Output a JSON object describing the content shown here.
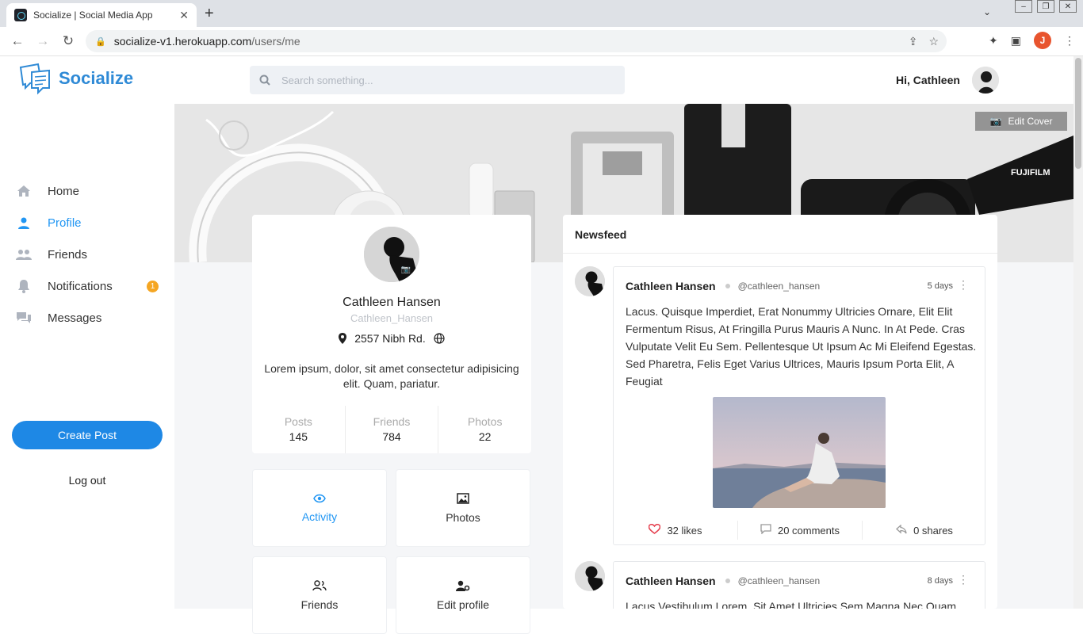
{
  "browser": {
    "tab_title": "Socialize | Social Media App",
    "url_host": "socialize-v1.herokuapp.com",
    "url_path": "/users/me",
    "profile_initial": "J"
  },
  "app": {
    "logo_text": "Socialize",
    "search_placeholder": "Search something...",
    "greeting": "Hi, Cathleen",
    "accent_color": "#1e88e5"
  },
  "sidebar": {
    "items": [
      {
        "label": "Home",
        "icon": "home-icon"
      },
      {
        "label": "Profile",
        "icon": "user-icon",
        "active": true
      },
      {
        "label": "Friends",
        "icon": "users-icon"
      },
      {
        "label": "Notifications",
        "icon": "bell-icon",
        "badge": "1"
      },
      {
        "label": "Messages",
        "icon": "chat-icon"
      }
    ],
    "create_post": "Create Post",
    "logout": "Log out"
  },
  "cover": {
    "edit_label": "Edit Cover"
  },
  "profile": {
    "name": "Cathleen Hansen",
    "handle": "Cathleen_Hansen",
    "location": "2557 Nibh Rd.",
    "bio": "Lorem ipsum, dolor, sit amet consectetur adipisicing elit. Quam, pariatur.",
    "stats": [
      {
        "label": "Posts",
        "value": "145"
      },
      {
        "label": "Friends",
        "value": "784"
      },
      {
        "label": "Photos",
        "value": "22"
      }
    ]
  },
  "tiles": [
    {
      "label": "Activity",
      "icon": "eye-icon",
      "active": true
    },
    {
      "label": "Photos",
      "icon": "image-icon"
    },
    {
      "label": "Friends",
      "icon": "users-icon"
    },
    {
      "label": "Edit profile",
      "icon": "user-gear-icon"
    }
  ],
  "newsfeed": {
    "title": "Newsfeed",
    "posts": [
      {
        "author": "Cathleen Hansen",
        "handle": "@cathleen_hansen",
        "time": "5 days",
        "body": "Lacus. Quisque Imperdiet, Erat Nonummy Ultricies Ornare, Elit Elit Fermentum Risus, At Fringilla Purus Mauris A Nunc. In At Pede. Cras Vulputate Velit Eu Sem. Pellentesque Ut Ipsum Ac Mi Eleifend Egestas. Sed Pharetra, Felis Eget Varius Ultrices, Mauris Ipsum Porta Elit, A Feugiat",
        "likes": "32 likes",
        "comments": "20 comments",
        "shares": "0 shares"
      },
      {
        "author": "Cathleen Hansen",
        "handle": "@cathleen_hansen",
        "time": "8 days",
        "body": "Lacus Vestibulum Lorem, Sit Amet Ultricies Sem Magna Nec Quam."
      }
    ]
  }
}
